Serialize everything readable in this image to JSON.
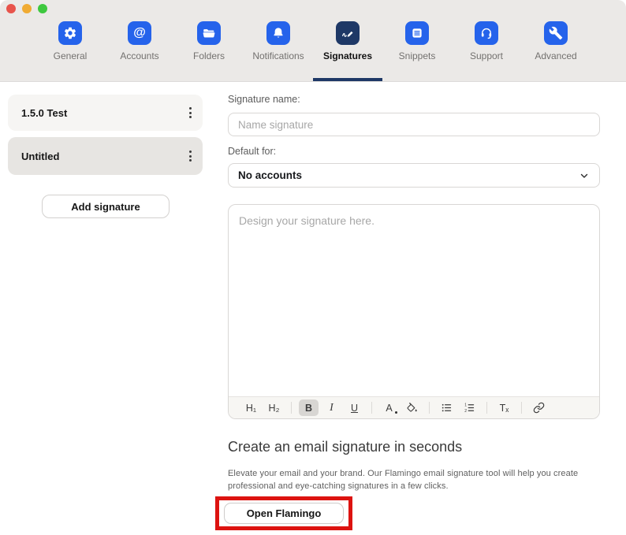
{
  "window": {
    "traffic_lights": [
      {
        "name": "close",
        "color": "#e8544c"
      },
      {
        "name": "minimize",
        "color": "#f0ab33"
      },
      {
        "name": "zoom",
        "color": "#3ec83f"
      }
    ]
  },
  "colors": {
    "tab_icon_blue": "#2563eb",
    "active_tab_navy": "#1e3866",
    "tabbar_background": "#ebe9e7",
    "annotation_red": "#dd1310",
    "selected_item_gray": "#e7e5e2"
  },
  "tabs": [
    {
      "label": "General",
      "icon": "gear-icon",
      "active": false
    },
    {
      "label": "Accounts",
      "icon": "at-icon",
      "active": false
    },
    {
      "label": "Folders",
      "icon": "folder-icon",
      "active": false
    },
    {
      "label": "Notifications",
      "icon": "bell-icon",
      "active": false
    },
    {
      "label": "Signatures",
      "icon": "signature-pen-icon",
      "active": true
    },
    {
      "label": "Snippets",
      "icon": "snippets-icon",
      "active": false
    },
    {
      "label": "Support",
      "icon": "headset-icon",
      "active": false
    },
    {
      "label": "Advanced",
      "icon": "wrench-icon",
      "active": false
    }
  ],
  "icons": {
    "at_glyph": "@"
  },
  "sidebar": {
    "items": [
      {
        "label": "1.5.0 Test",
        "selected": false,
        "menu_icon": "kebab-menu-icon"
      },
      {
        "label": "Untitled",
        "selected": true,
        "menu_icon": "kebab-menu-icon"
      }
    ],
    "add_button_label": "Add signature"
  },
  "form": {
    "signature_name_label": "Signature name:",
    "signature_name_value": "",
    "signature_name_placeholder": "Name signature",
    "default_for_label": "Default for:",
    "default_for_value": "No accounts",
    "editor_placeholder": "Design your signature here.",
    "toolbar": {
      "buttons": [
        {
          "name": "heading1",
          "glyph": "H₁"
        },
        {
          "name": "heading2",
          "glyph": "H₂"
        },
        {
          "name": "bold",
          "glyph": "B",
          "active": true
        },
        {
          "name": "italic",
          "glyph": "I"
        },
        {
          "name": "underline",
          "glyph": "U"
        },
        {
          "name": "text-color",
          "glyph": "A"
        },
        {
          "name": "highlight-color",
          "glyph": "paint-bucket-icon"
        },
        {
          "name": "bullet-list",
          "glyph": "list-unordered-icon"
        },
        {
          "name": "ordered-list",
          "glyph": "list-ordered-icon"
        },
        {
          "name": "clear-formatting",
          "glyph": "Tₓ"
        },
        {
          "name": "link",
          "glyph": "link-icon"
        }
      ]
    }
  },
  "promo": {
    "heading": "Create an email signature in seconds",
    "body": "Elevate your email and your brand. Our Flamingo email signature tool will help you create professional and eye-catching signatures in a few clicks.",
    "button_label": "Open Flamingo"
  }
}
